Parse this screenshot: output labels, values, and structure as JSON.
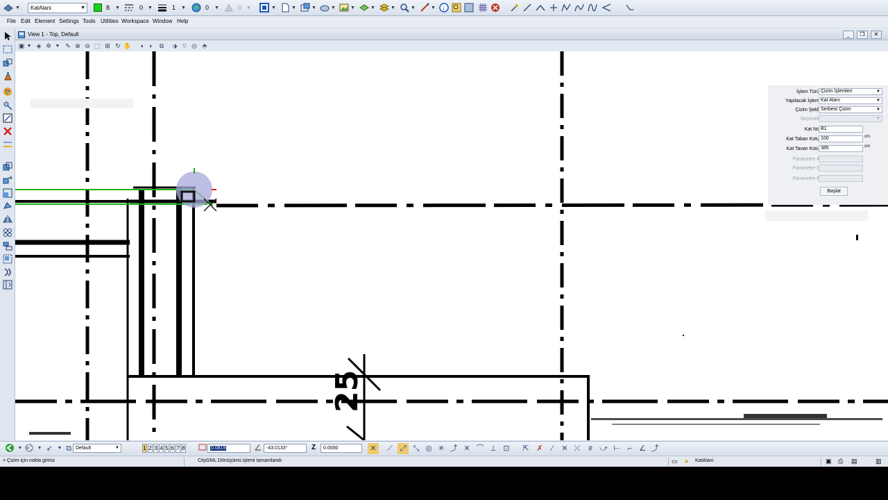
{
  "attribute_bar": {
    "level_value": "KatAlani",
    "color_value": "8",
    "line_style_value": "0",
    "line_weight_value": "1",
    "transparency_value": "0",
    "priority_value": "0",
    "active_color_hex": "#19d219"
  },
  "menu": {
    "items": [
      "File",
      "Edit",
      "Element",
      "Settings",
      "Tools",
      "Utilities",
      "Workspace",
      "Window",
      "Help"
    ]
  },
  "view": {
    "title": "View 1 - Top, Default",
    "minimize_icon": "minimize-icon",
    "restore_icon": "restore-icon",
    "close_icon": "close-icon"
  },
  "panel": {
    "islem_turu_label": "İşlem Türü",
    "islem_turu_value": "Çizim İşlemleri",
    "yapilacak_label": "Yapılacak İşlem",
    "yapilacak_value": "Kat Alanı",
    "cizim_sekli_label": "Çizim Şekli",
    "cizim_sekli_value": "Serbest Çizim",
    "secenek_label": "Seçenek",
    "secenek_value": "",
    "kat_no_label": "Kat No",
    "kat_no_value": "B1",
    "kat_taban_label": "Kat Taban Kotu",
    "kat_taban_value": "100",
    "kat_taban_unit": "cm",
    "kat_tavan_label": "Kat Tavan Kotu",
    "kat_tavan_value": "385",
    "kat_tavan_unit": "cm",
    "param4_label": "Parametre 4",
    "param5_label": "Parametre 5",
    "param6_label": "Parametre 6",
    "start_button": "Başlat"
  },
  "bottom_bar": {
    "view_group": "Default",
    "view_numbers": [
      "1",
      "2",
      "3",
      "4",
      "5",
      "6",
      "7",
      "8"
    ],
    "active_view": "1",
    "distance_value": "0.0819",
    "angle_value": "-43.0133°",
    "z_label": "Z",
    "z_value": "0.0000"
  },
  "status_bar": {
    "prompt": "> Çizim için nokta giriniz",
    "message": "CityGML Dönüşümü işlemi tamamlandı",
    "level": "KatAlani"
  },
  "drawing": {
    "dimension_text": "25"
  }
}
